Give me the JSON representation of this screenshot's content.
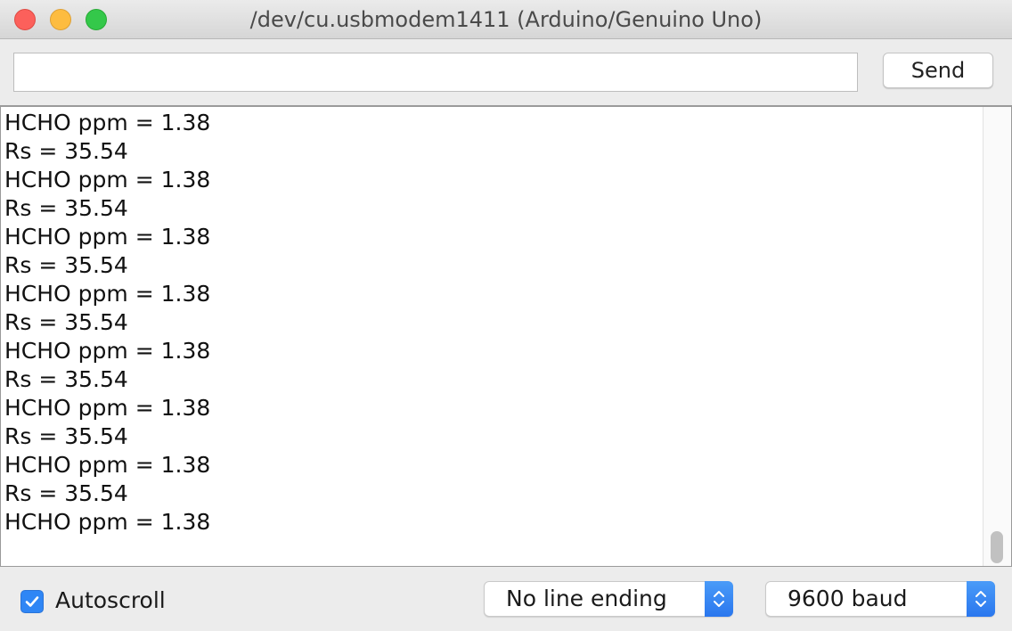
{
  "window": {
    "title": "/dev/cu.usbmodem1411 (Arduino/Genuino Uno)"
  },
  "input": {
    "value": "",
    "placeholder": ""
  },
  "toolbar": {
    "send_label": "Send"
  },
  "output": {
    "lines": [
      "HCHO ppm = 1.38",
      "Rs = 35.54",
      "HCHO ppm = 1.38",
      "Rs = 35.54",
      "HCHO ppm = 1.38",
      "Rs = 35.54",
      "HCHO ppm = 1.38",
      "Rs = 35.54",
      "HCHO ppm = 1.38",
      "Rs = 35.54",
      "HCHO ppm = 1.38",
      "Rs = 35.54",
      "HCHO ppm = 1.38",
      "Rs = 35.54",
      "HCHO ppm = 1.38"
    ]
  },
  "footer": {
    "autoscroll_label": "Autoscroll",
    "autoscroll_checked": true,
    "line_ending": "No line ending",
    "baud_rate": "9600 baud"
  },
  "icons": {
    "checkbox": "checkmark-icon",
    "stepper": "up-down-chevron-icon"
  },
  "colors": {
    "close": "#fc605b",
    "minimize": "#fdbc40",
    "zoom": "#34c84a",
    "accent": "#2f86f5"
  }
}
